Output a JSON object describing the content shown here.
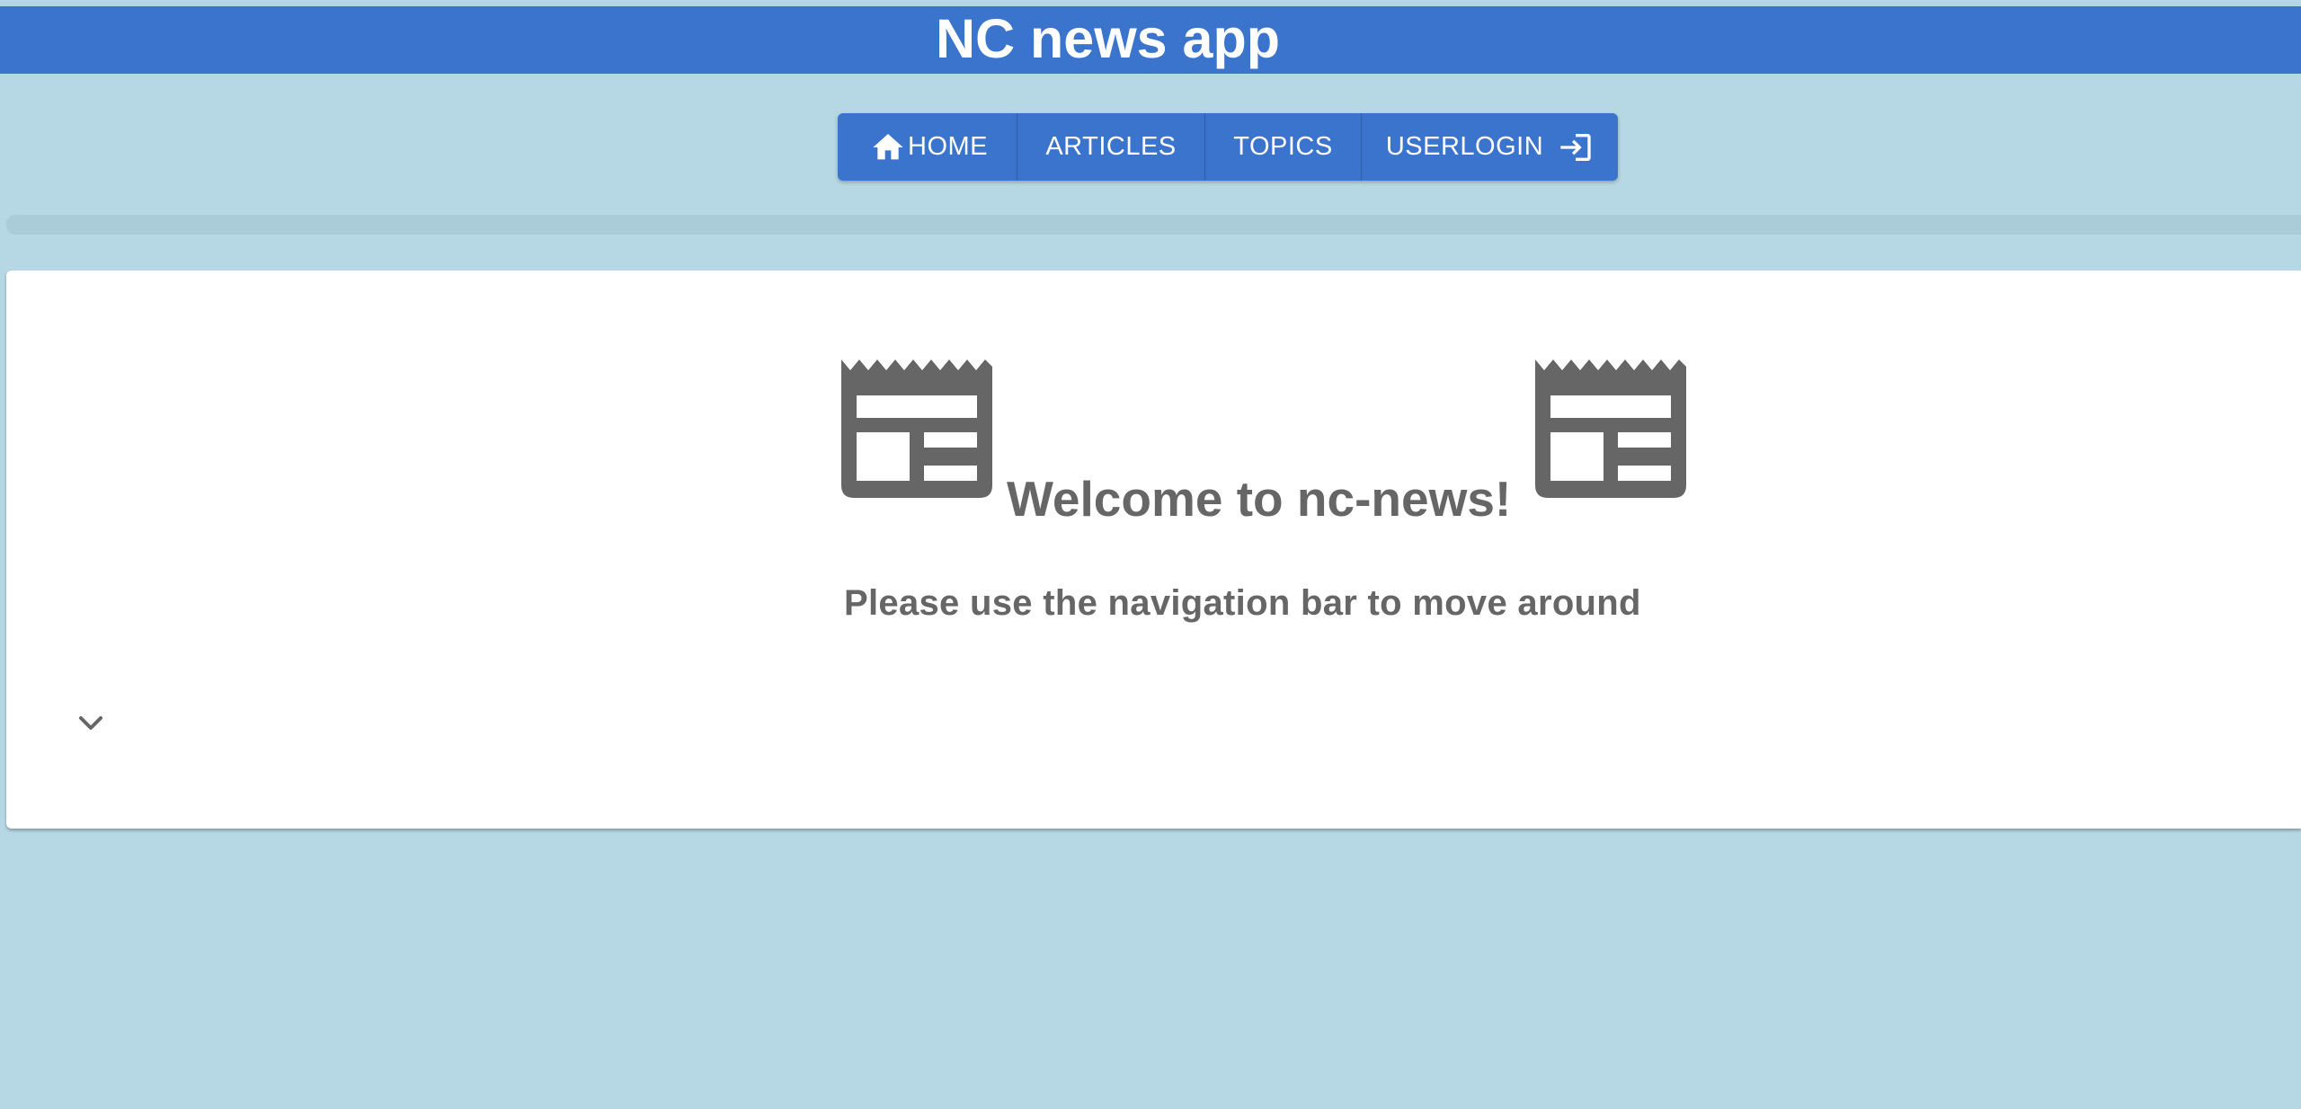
{
  "header": {
    "title": "NC news app"
  },
  "nav": {
    "items": [
      {
        "label": "HOME",
        "icon": "home-icon"
      },
      {
        "label": "ARTICLES"
      },
      {
        "label": "TOPICS"
      },
      {
        "label": "USERLOGIN",
        "icon": "login-icon"
      }
    ]
  },
  "main": {
    "welcome": "Welcome to nc-news!",
    "subtitle": "Please use the navigation bar to move around",
    "decorative_icon": "newspaper-icon",
    "expand_icon": "chevron-down-icon"
  },
  "colors": {
    "background": "#b5d8e4",
    "header": "#3a74cc",
    "nav": "#3a74cc",
    "text_muted": "#666666",
    "card": "#ffffff"
  }
}
